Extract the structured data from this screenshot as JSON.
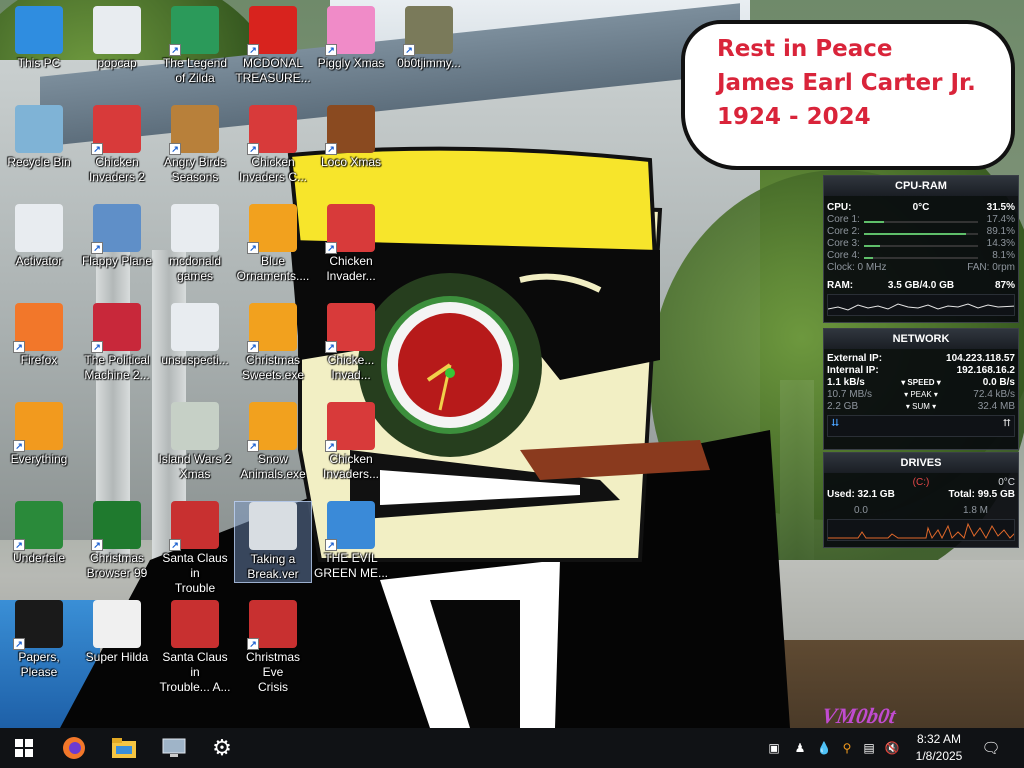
{
  "speech_bubble": {
    "line1": "Rest in Peace",
    "line2": "James Earl Carter Jr.",
    "line3": "1924 - 2024"
  },
  "watermark": "VM0b0t",
  "desktop_icons": [
    {
      "label": "This PC",
      "icon": "computer-icon"
    },
    {
      "label": "popcap",
      "icon": "folder-icon"
    },
    {
      "label": "The Legend\nof Zilda",
      "icon": "game-icon"
    },
    {
      "label": "MCDONAL\nTREASURE...",
      "icon": "mcdonalds-icon"
    },
    {
      "label": "Piggly Xmas",
      "icon": "pig-icon"
    },
    {
      "label": "0b0tjimmy...",
      "icon": "image-icon"
    },
    {
      "label": "Recycle Bin",
      "icon": "recycle-bin-icon"
    },
    {
      "label": "Chicken\nInvaders 2",
      "icon": "chicken-icon"
    },
    {
      "label": "Angry Birds\nSeasons",
      "icon": "angry-birds-icon"
    },
    {
      "label": "Chicken\nInvaders C...",
      "icon": "chicken-icon"
    },
    {
      "label": "Loco Xmas",
      "icon": "bear-icon"
    },
    {
      "label": "Activator",
      "icon": "folder-icon"
    },
    {
      "label": "Flappy Plane",
      "icon": "plane-icon"
    },
    {
      "label": "mcdonald\ngames",
      "icon": "folder-icon"
    },
    {
      "label": "Blue\nOrnaments....",
      "icon": "puzzle-icon"
    },
    {
      "label": "Chicken\nInvader...",
      "icon": "chicken-icon"
    },
    {
      "label": "Firefox",
      "icon": "firefox-icon"
    },
    {
      "label": "The Political\nMachine 2...",
      "icon": "political-icon"
    },
    {
      "label": "unsuspecti...",
      "icon": "folder-icon"
    },
    {
      "label": "Christmas\nSweets.exe",
      "icon": "puzzle-icon"
    },
    {
      "label": "Chicke...\nInvad...",
      "icon": "chicken-icon"
    },
    {
      "label": "Everything",
      "icon": "search-icon"
    },
    {
      "label": "Island Wars 2\nXmas",
      "icon": "island-icon"
    },
    {
      "label": "Snow\nAnimals.exe",
      "icon": "puzzle-icon"
    },
    {
      "label": "Chicken\nInvaders...",
      "icon": "chicken-icon"
    },
    {
      "label": "Undertale",
      "icon": "undertale-icon"
    },
    {
      "label": "Christmas\nBrowser 99",
      "icon": "tree-icon"
    },
    {
      "label": "Santa Claus in\nTrouble",
      "icon": "santa-icon"
    },
    {
      "label": "Taking a\nBreak.ver",
      "icon": "file-icon"
    },
    {
      "label": "THE EVIL\nGREEN ME...",
      "icon": "messenger-icon"
    },
    {
      "label": "Papers, Please",
      "icon": "papers-icon"
    },
    {
      "label": "Super Hilda",
      "icon": "hilda-icon"
    },
    {
      "label": "Santa Claus in\nTrouble... A...",
      "icon": "santa-icon"
    },
    {
      "label": "Christmas Eve\nCrisis",
      "icon": "santa-icon"
    }
  ],
  "cpu_ram": {
    "title": "CPU-RAM",
    "cpu_label": "CPU:",
    "cpu_temp": "0°C",
    "cpu_usage": "31.5%",
    "cores": [
      {
        "label": "Core 1:",
        "value": "17.4%",
        "level": 17.4
      },
      {
        "label": "Core 2:",
        "value": "89.1%",
        "level": 89.1
      },
      {
        "label": "Core 3:",
        "value": "14.3%",
        "level": 14.3
      },
      {
        "label": "Core 4:",
        "value": "8.1%",
        "level": 8.1
      }
    ],
    "clock": "Clock: 0 MHz",
    "fan": "FAN: 0rpm",
    "ram_label": "RAM:",
    "ram_value": "3.5 GB/4.0 GB",
    "ram_percent": "87%"
  },
  "network": {
    "title": "NETWORK",
    "external_label": "External IP:",
    "external_ip": "104.223.118.57",
    "internal_label": "Internal IP:",
    "internal_ip": "192.168.16.2",
    "speed_down": "1.1 kB/s",
    "speed_label": "▾ SPEED ▾",
    "speed_up": "0.0 B/s",
    "peak_down": "10.7 MB/s",
    "peak_label": "▾ PEAK ▾",
    "peak_up": "72.4 kB/s",
    "sum_down": "2.2 GB",
    "sum_label": "▾ SUM ▾",
    "sum_up": "32.4 MB"
  },
  "drives": {
    "title": "DRIVES",
    "drive_letter": "(C:)",
    "temp": "0°C",
    "used": "Used: 32.1 GB",
    "total": "Total: 99.5 GB",
    "read": "0.0",
    "write": "1.8 M"
  },
  "taskbar": {
    "pinned": [
      "start-icon",
      "firefox-icon",
      "file-explorer-icon",
      "display-icon",
      "settings-icon"
    ],
    "time": "8:32 AM",
    "date": "1/8/2025"
  },
  "colors": {
    "bubble_text": "#d9243a",
    "gadget_bg": "#08090d",
    "taskbar": "#101215",
    "watermark": "#c04bd0"
  }
}
